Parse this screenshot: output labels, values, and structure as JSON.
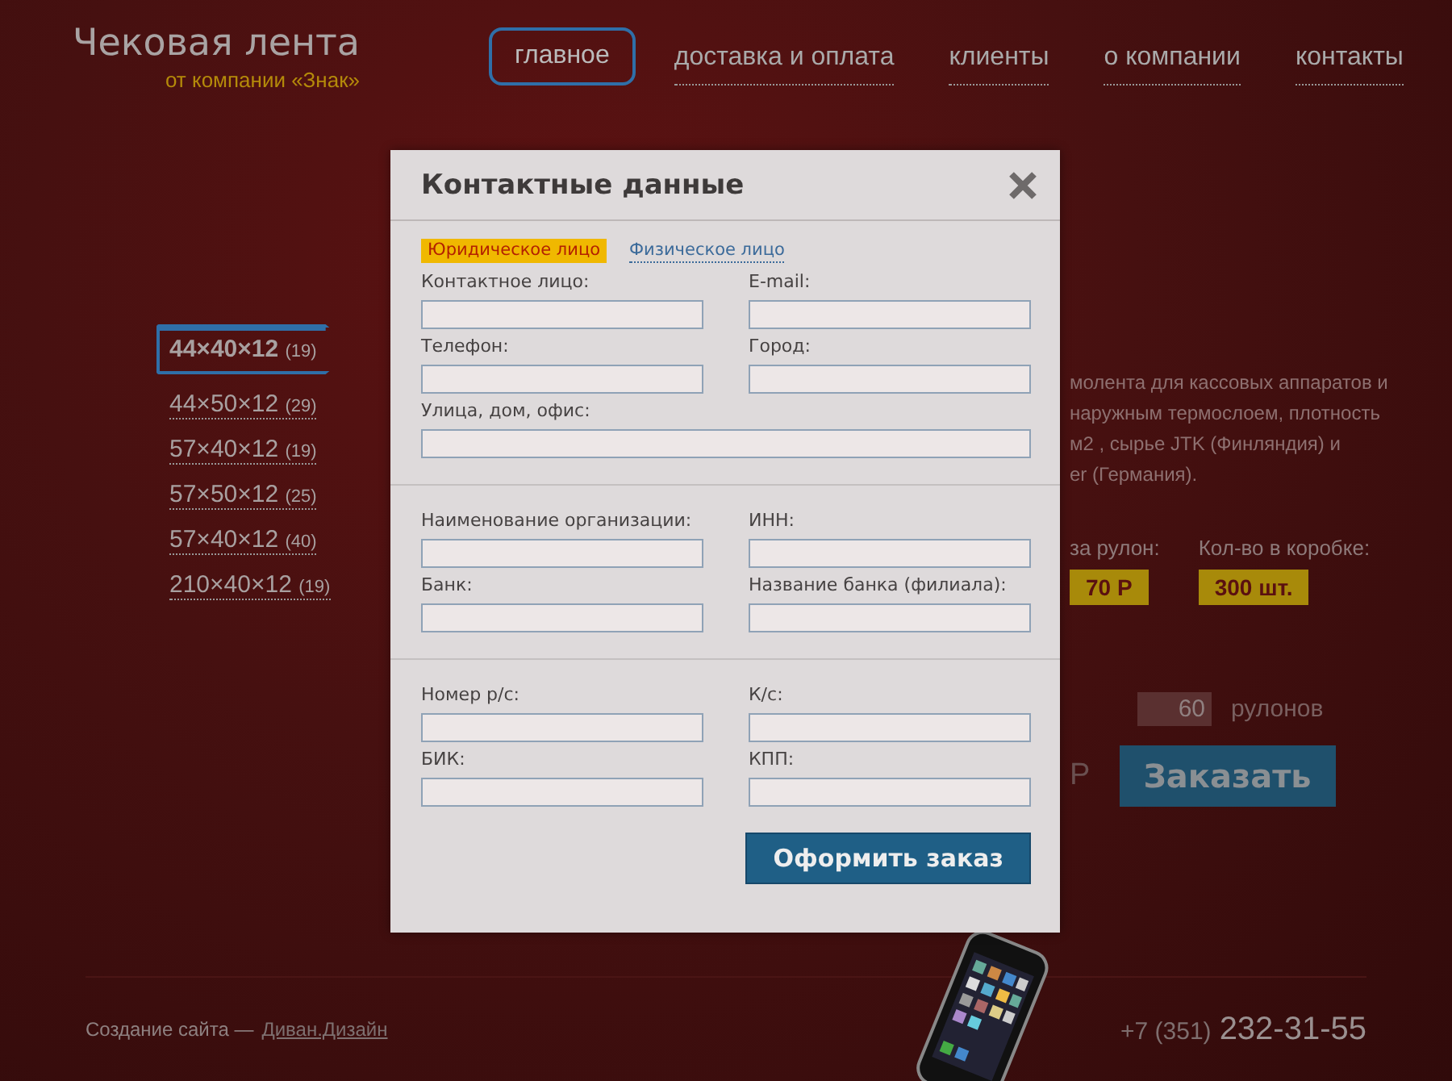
{
  "header": {
    "logo_title": "Чековая лента",
    "logo_subtitle": "от компании «Знак»",
    "nav": [
      {
        "label": "главное",
        "selected": true
      },
      {
        "label": "доставка и оплата",
        "selected": false
      },
      {
        "label": "клиенты",
        "selected": false
      },
      {
        "label": "о компании",
        "selected": false
      },
      {
        "label": "контакты",
        "selected": false
      }
    ]
  },
  "sidebar": {
    "items": [
      {
        "size": "44×40×12",
        "count": "(19)",
        "selected": true
      },
      {
        "size": "44×50×12",
        "count": "(29)",
        "selected": false
      },
      {
        "size": "57×40×12",
        "count": "(19)",
        "selected": false
      },
      {
        "size": "57×50×12",
        "count": "(25)",
        "selected": false
      },
      {
        "size": "57×40×12",
        "count": "(40)",
        "selected": false
      },
      {
        "size": "210×40×12",
        "count": "(19)",
        "selected": false
      }
    ]
  },
  "product": {
    "description": [
      "молента для кассовых аппаратов и",
      "наружным термослоем, плотность",
      "м2 , сырье JTK (Финляндия) и",
      "er (Германия)."
    ],
    "price_label": "за рулон:",
    "price": "70 Р",
    "box_label": "Кол-во в коробке:",
    "box_qty": "300 шт.",
    "quantity": "60",
    "quantity_unit": "рулонов",
    "total": "Р",
    "order_button": "Заказать"
  },
  "modal": {
    "title": "Контактные данные",
    "tabs": [
      {
        "label": "Юридическое лицо",
        "selected": true
      },
      {
        "label": "Физическое лицо",
        "selected": false
      }
    ],
    "sections": [
      {
        "fields": [
          {
            "label": "Контактное лицо:",
            "kind": "half"
          },
          {
            "label": "E-mail:",
            "kind": "half"
          },
          {
            "label": "Телефон:",
            "kind": "half"
          },
          {
            "label": "Город:",
            "kind": "half"
          },
          {
            "label": "Улица, дом, офис:",
            "kind": "full"
          }
        ]
      },
      {
        "fields": [
          {
            "label": "Наименование организации:",
            "kind": "half"
          },
          {
            "label": "ИНН:",
            "kind": "half"
          },
          {
            "label": "Банк:",
            "kind": "half"
          },
          {
            "label": "Название банка (филиала):",
            "kind": "half"
          }
        ]
      },
      {
        "fields": [
          {
            "label": "Номер р/с:",
            "kind": "half"
          },
          {
            "label": "К/с:",
            "kind": "half"
          },
          {
            "label": "БИК:",
            "kind": "half"
          },
          {
            "label": "КПП:",
            "kind": "half"
          }
        ]
      }
    ],
    "submit": "Оформить заказ"
  },
  "footer": {
    "credit": "Создание сайта —",
    "credit_link": "Диван.Дизайн",
    "phone_code": "+7 (351)",
    "phone_number": "232-31-55"
  }
}
